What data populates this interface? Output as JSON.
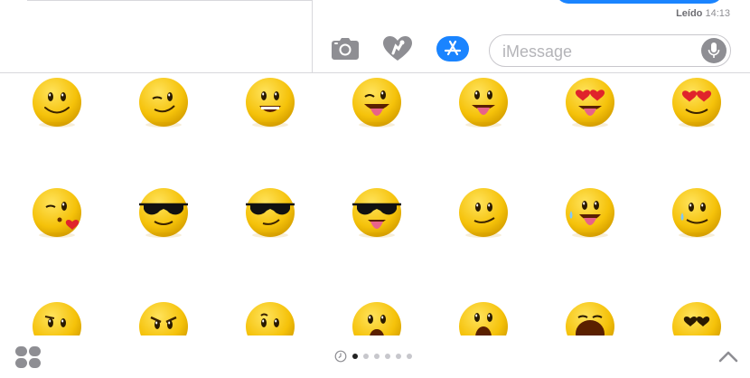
{
  "conversation": {
    "read_status": "Leído",
    "read_time": "14:13"
  },
  "compose": {
    "placeholder": "iMessage"
  },
  "toolbar": {
    "camera_icon": "camera-icon",
    "digital_touch_icon": "digital-touch-heart-icon",
    "app_store_icon": "app-store-icon",
    "mic_icon": "microphone-icon",
    "accent_color": "#1a84ff"
  },
  "sticker_pack": {
    "rows": [
      [
        "smile",
        "wink-smirk",
        "grin",
        "wink-tongue",
        "tongue-out",
        "heart-eyes-tongue",
        "heart-eyes-smile"
      ],
      [
        "kiss-heart",
        "sunglasses",
        "sunglasses-smirk",
        "sunglasses-tongue",
        "smirk",
        "tongue-sweat",
        "tear-smile"
      ],
      [
        "confused",
        "angry",
        "worried",
        "shocked",
        "scream",
        "yawn",
        "heart-eyes-partial"
      ]
    ]
  },
  "pager": {
    "recent_icon": "clock-icon",
    "page_count": 6,
    "active_index": 0
  },
  "bottom_bar": {
    "apps_icon": "app-drawer-icon",
    "expand_icon": "chevron-up-icon"
  }
}
